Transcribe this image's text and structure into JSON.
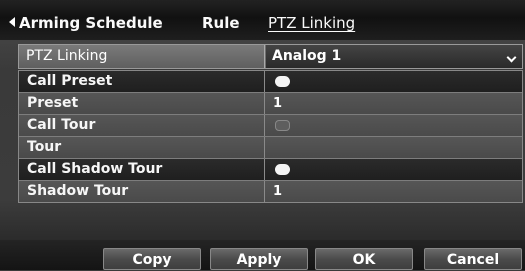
{
  "tabs": {
    "arming_schedule": "Arming Schedule",
    "rule": "Rule",
    "ptz_linking": "PTZ Linking"
  },
  "ptz_linking": {
    "label": "PTZ Linking",
    "selected": "Analog 1"
  },
  "rows": [
    {
      "label": "Call Preset",
      "type": "toggle",
      "state": "on"
    },
    {
      "label": "Preset",
      "type": "value",
      "value": "1"
    },
    {
      "label": "Call Tour",
      "type": "toggle",
      "state": "off"
    },
    {
      "label": "Tour",
      "type": "value",
      "value": ""
    },
    {
      "label": "Call Shadow Tour",
      "type": "toggle",
      "state": "on"
    },
    {
      "label": "Shadow Tour",
      "type": "value",
      "value": "1"
    }
  ],
  "buttons": {
    "copy": "Copy",
    "apply": "Apply",
    "ok": "OK",
    "cancel": "Cancel"
  }
}
